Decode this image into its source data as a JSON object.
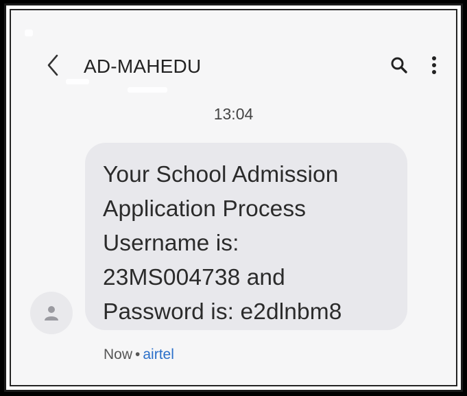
{
  "header": {
    "back_icon": "chevron-left-icon",
    "title": "AD-MAHEDU",
    "search_icon": "search-icon",
    "more_icon": "more-vertical-icon"
  },
  "conversation": {
    "timestamp": "13:04",
    "message": {
      "text": "Your School Admission\nApplication Process\nUsername is:\n23MS004738 and\nPassword is: e2dlnbm8",
      "sender_avatar_icon": "person-icon"
    },
    "status": {
      "time": "Now",
      "separator": "•",
      "carrier": "airtel"
    }
  },
  "colors": {
    "background": "#f6f6f7",
    "bubble": "#e8e8ec",
    "carrier_link": "#2a6fc9",
    "text": "#2b2b2b"
  }
}
